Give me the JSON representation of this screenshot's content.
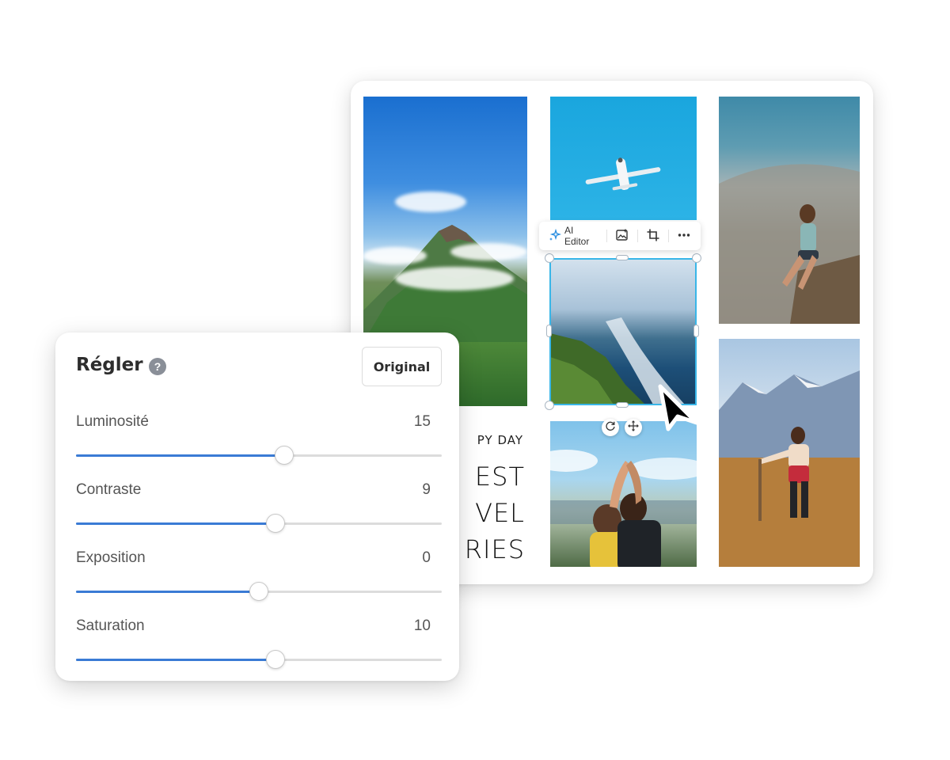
{
  "toolbar": {
    "ai_editor_label": "AI Editor",
    "icons": [
      "sparkle-icon",
      "image-replace-icon",
      "crop-icon",
      "more-icon"
    ]
  },
  "collage_text": {
    "line1": "PY DAY",
    "line2": "EST",
    "line3": "VEL",
    "line4": "RIES"
  },
  "panel": {
    "title": "Régler",
    "original_button": "Original",
    "sliders": [
      {
        "label": "Luminosité",
        "value": "15",
        "position": 0.57
      },
      {
        "label": "Contraste",
        "value": "9",
        "position": 0.545
      },
      {
        "label": "Exposition",
        "value": "0",
        "position": 0.5
      },
      {
        "label": "Saturation",
        "value": "10",
        "position": 0.545
      }
    ]
  },
  "colors": {
    "accent": "#3a7bd5",
    "selection": "#39b6e8"
  }
}
